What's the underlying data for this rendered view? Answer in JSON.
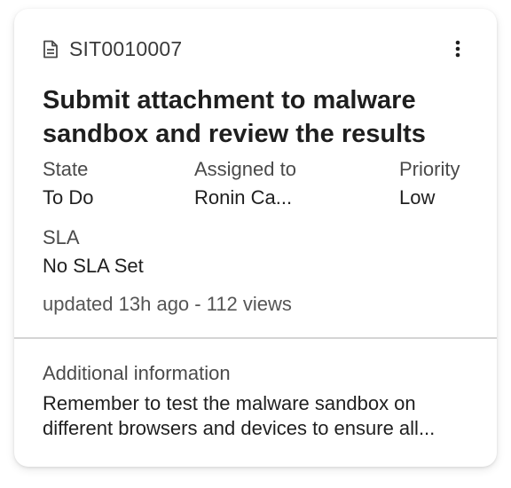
{
  "card": {
    "record_id": "SIT0010007",
    "title": "Submit attachment to malware sandbox and review the results",
    "fields": {
      "state": {
        "label": "State",
        "value": "To Do"
      },
      "assigned_to": {
        "label": "Assigned to",
        "value": "Ronin Ca..."
      },
      "priority": {
        "label": "Priority",
        "value": "Low"
      },
      "sla": {
        "label": "SLA",
        "value": "No SLA Set"
      }
    },
    "meta": "updated 13h ago - 112 views",
    "additional_info": {
      "label": "Additional information",
      "text": "Remember to test the malware sandbox on different browsers and devices to ensure all..."
    },
    "icons": {
      "record": "document-icon",
      "menu": "more-vertical-icon"
    }
  }
}
